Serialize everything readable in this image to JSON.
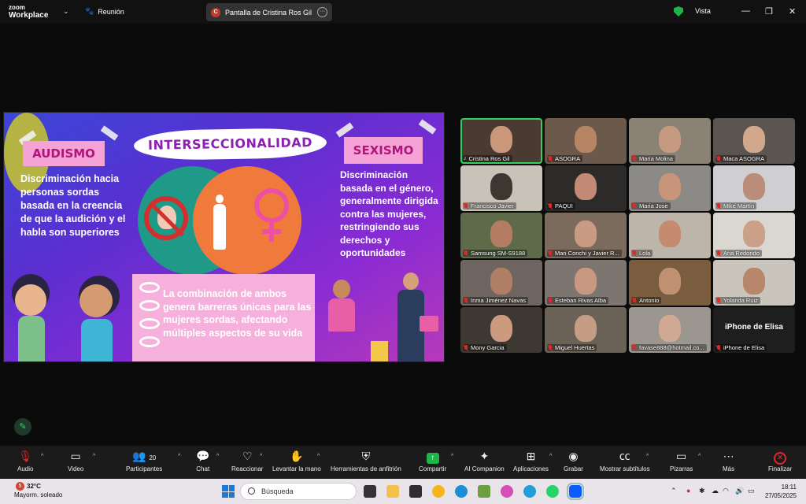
{
  "titlebar": {
    "brand_line1": "zoom",
    "brand_line2": "Workplace",
    "meeting_label": "Reunión",
    "share_label": "Pantalla de Cristina Ros Gil",
    "share_avatar": "C",
    "view_label": "Vista",
    "minimize_glyph": "—",
    "restore_glyph": "❐",
    "close_glyph": "✕"
  },
  "slide": {
    "tag_left": "AUDISMO",
    "tag_right": "SEXISMO",
    "banner": "INTERSECCIONALIDAD",
    "text_left": "Discriminación hacia personas sordas basada en la creencia de que la audición y el habla son superiores",
    "text_right": "Discriminación basada en el género, generalmente dirigida contra las mujeres, restringiendo sus derechos y oportunidades",
    "text_bottom": "La combinación de ambos genera barreras únicas para las mujeres sordas, afectando múltiples aspectos de su vida"
  },
  "participants": [
    {
      "name": "Cristina Ros Gil",
      "active": true,
      "bg": "#4a3a32",
      "skin": "#c99779",
      "mic": "speaking"
    },
    {
      "name": "ASOGRA",
      "bg": "#6b5a4c",
      "skin": "#b88564",
      "mic": "off"
    },
    {
      "name": "Maria Molina",
      "bg": "#8a8275",
      "skin": "#c69a80",
      "mic": "off"
    },
    {
      "name": "Maca ASOGRA",
      "bg": "#5b5451",
      "skin": "#d2a88d",
      "mic": "off"
    },
    {
      "name": "Francisco Javier",
      "bg": "#c9c2b8",
      "skin": "#3e3631",
      "mic": "off"
    },
    {
      "name": "PAQUI",
      "bg": "#2d2a2a",
      "skin": "#c28a74",
      "mic": "off"
    },
    {
      "name": "Maria Jose",
      "bg": "#8c8a86",
      "skin": "#c9957a",
      "mic": "off"
    },
    {
      "name": "Mike Martín",
      "bg": "#cfcfd1",
      "skin": "#b98d7a",
      "mic": "off"
    },
    {
      "name": "Samsung SM-S9188",
      "bg": "#5d6b4a",
      "skin": "#b47d63",
      "mic": "off"
    },
    {
      "name": "Mari Conchi y Javier R...",
      "bg": "#7a6b5d",
      "skin": "#c99b82",
      "mic": "off"
    },
    {
      "name": "Lola",
      "bg": "#bdb5aa",
      "skin": "#c48b70",
      "mic": "off"
    },
    {
      "name": "Ana Redondo",
      "bg": "#d9d7cf",
      "skin": "#caa188",
      "mic": "off"
    },
    {
      "name": "Inma Jiménez Navas",
      "bg": "#6e6560",
      "skin": "#b07e64",
      "mic": "off"
    },
    {
      "name": "Esteban Rivas Alba",
      "bg": "#7d7570",
      "skin": "#c79780",
      "mic": "off"
    },
    {
      "name": "Antonio",
      "bg": "#7a5d3f",
      "skin": "#c09073",
      "mic": "off"
    },
    {
      "name": "Yolanda Ruiz",
      "bg": "#c9c5bd",
      "skin": "#b7866b",
      "mic": "off"
    },
    {
      "name": "Mony Garcia",
      "bg": "#3e3833",
      "skin": "#cc9a7f",
      "mic": "off"
    },
    {
      "name": "Miguel Huertas",
      "bg": "#6a6257",
      "skin": "#c59c84",
      "mic": "off"
    },
    {
      "name": "favase888@hotmail.co...",
      "bg": "#9c9690",
      "skin": "#d1a893",
      "mic": "off"
    },
    {
      "name": "iPhone de Elisa",
      "bg": "#1e1e1e",
      "skin": "",
      "mic": "off",
      "noimg": true,
      "bigname": "iPhone de Elisa"
    }
  ],
  "toolbar": {
    "audio": "Audio",
    "video": "Video",
    "participants": "Participantes",
    "participants_count": "20",
    "chat": "Chat",
    "react": "Reaccionar",
    "raise_hand": "Levantar la mano",
    "host_tools": "Herramientas de anfitrión",
    "share": "Compartir",
    "ai": "AI Companion",
    "apps": "Aplicaciones",
    "record": "Grabar",
    "subtitles": "Mostrar subtítulos",
    "whiteboards": "Pizarras",
    "more": "Más",
    "end": "Finalizar"
  },
  "taskbar": {
    "weather_temp": "32°C",
    "weather_desc": "Mayorm. soleado",
    "weather_badge": "5",
    "search_placeholder": "Búsqueda",
    "time": "18:11",
    "date": "27/05/2025"
  },
  "colors": {
    "active_border": "#2fd35c",
    "mic_off": "#e02828",
    "share_green": "#22b24c"
  }
}
